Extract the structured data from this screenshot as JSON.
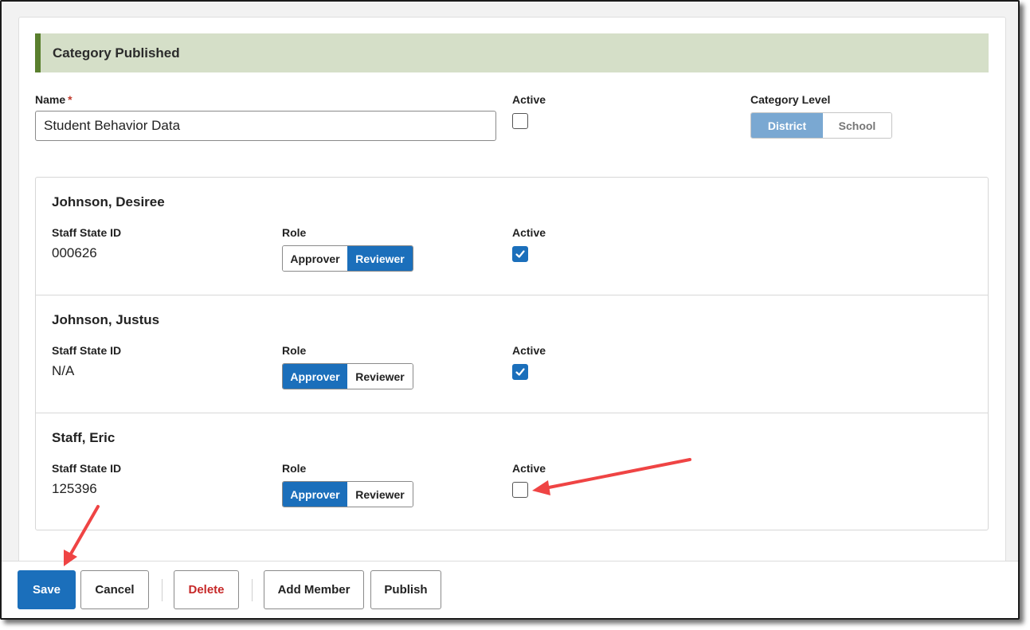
{
  "header": {
    "title": "Category Published"
  },
  "form": {
    "name_label": "Name",
    "required_mark": "*",
    "name_value": "Student Behavior Data",
    "active_label": "Active",
    "active_checked": false,
    "category_level_label": "Category Level",
    "category_level_options": [
      "District",
      "School"
    ],
    "category_level_selected": "District"
  },
  "members": [
    {
      "name": "Johnson, Desiree",
      "staff_state_id_label": "Staff State ID",
      "staff_state_id": "000626",
      "role_label": "Role",
      "role_options": [
        "Approver",
        "Reviewer"
      ],
      "role_selected": "Reviewer",
      "active_label": "Active",
      "active": true
    },
    {
      "name": "Johnson, Justus",
      "staff_state_id_label": "Staff State ID",
      "staff_state_id": "N/A",
      "role_label": "Role",
      "role_options": [
        "Approver",
        "Reviewer"
      ],
      "role_selected": "Approver",
      "active_label": "Active",
      "active": true
    },
    {
      "name": "Staff, Eric",
      "staff_state_id_label": "Staff State ID",
      "staff_state_id": "125396",
      "role_label": "Role",
      "role_options": [
        "Approver",
        "Reviewer"
      ],
      "role_selected": "Approver",
      "active_label": "Active",
      "active": false
    }
  ],
  "toolbar": {
    "save_label": "Save",
    "cancel_label": "Cancel",
    "delete_label": "Delete",
    "add_member_label": "Add Member",
    "publish_label": "Publish"
  },
  "colors": {
    "primary": "#1b6fbb",
    "header_bg": "#d5dfc8",
    "header_accent": "#5a7f2e",
    "danger": "#c62828",
    "annotation_arrow": "#ef4444"
  },
  "icons": {
    "checkbox_checked": "checkmark-icon",
    "annotation": "red-arrow-icon"
  }
}
